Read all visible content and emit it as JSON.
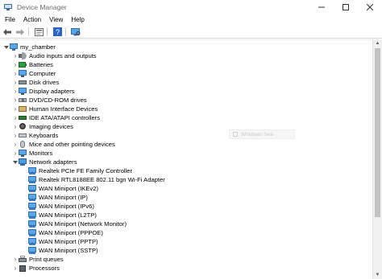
{
  "window": {
    "title": "Device Manager",
    "controls": {
      "minimize": "–",
      "maximize": "☐",
      "close": "✕"
    }
  },
  "menu": [
    "File",
    "Action",
    "View",
    "Help"
  ],
  "toolbar": {
    "buttons": [
      "back-arrow-icon",
      "forward-arrow-icon",
      "properties-icon",
      "help-icon",
      "scan-hardware-icon"
    ]
  },
  "tree": {
    "root": {
      "label": "my_chamber",
      "expanded": true
    },
    "categories": [
      {
        "label": "Audio inputs and outputs",
        "icon": "audio-icon",
        "expanded": false
      },
      {
        "label": "Batteries",
        "icon": "battery-icon",
        "expanded": false
      },
      {
        "label": "Computer",
        "icon": "computer-icon",
        "expanded": false
      },
      {
        "label": "Disk drives",
        "icon": "disk-drive-icon",
        "expanded": false
      },
      {
        "label": "Display adapters",
        "icon": "display-adapter-icon",
        "expanded": false
      },
      {
        "label": "DVD/CD-ROM drives",
        "icon": "dvd-drive-icon",
        "expanded": false
      },
      {
        "label": "Human Interface Devices",
        "icon": "hid-icon",
        "expanded": false
      },
      {
        "label": "IDE ATA/ATAPI controllers",
        "icon": "ide-controller-icon",
        "expanded": false
      },
      {
        "label": "Imaging devices",
        "icon": "camera-icon",
        "expanded": false
      },
      {
        "label": "Keyboards",
        "icon": "keyboard-icon",
        "expanded": false
      },
      {
        "label": "Mice and other pointing devices",
        "icon": "mouse-icon",
        "expanded": false
      },
      {
        "label": "Monitors",
        "icon": "monitor-icon",
        "expanded": false
      },
      {
        "label": "Network adapters",
        "icon": "network-adapter-icon",
        "expanded": true
      },
      {
        "label": "Print queues",
        "icon": "printer-icon",
        "expanded": false
      },
      {
        "label": "Processors",
        "icon": "processor-icon",
        "expanded": false
      }
    ],
    "network_adapters": [
      "Realtek PCIe FE Family Controller",
      "Realtek RTL8188EE 802.11 bgn Wi-Fi Adapter",
      "WAN Miniport (IKEv2)",
      "WAN Miniport (IP)",
      "WAN Miniport (IPv6)",
      "WAN Miniport (L2TP)",
      "WAN Miniport (Network Monitor)",
      "WAN Miniport (PPPOE)",
      "WAN Miniport (PPTP)",
      "WAN Miniport (SSTP)"
    ]
  },
  "ghost_tooltip": {
    "text": "Windows Sea"
  }
}
